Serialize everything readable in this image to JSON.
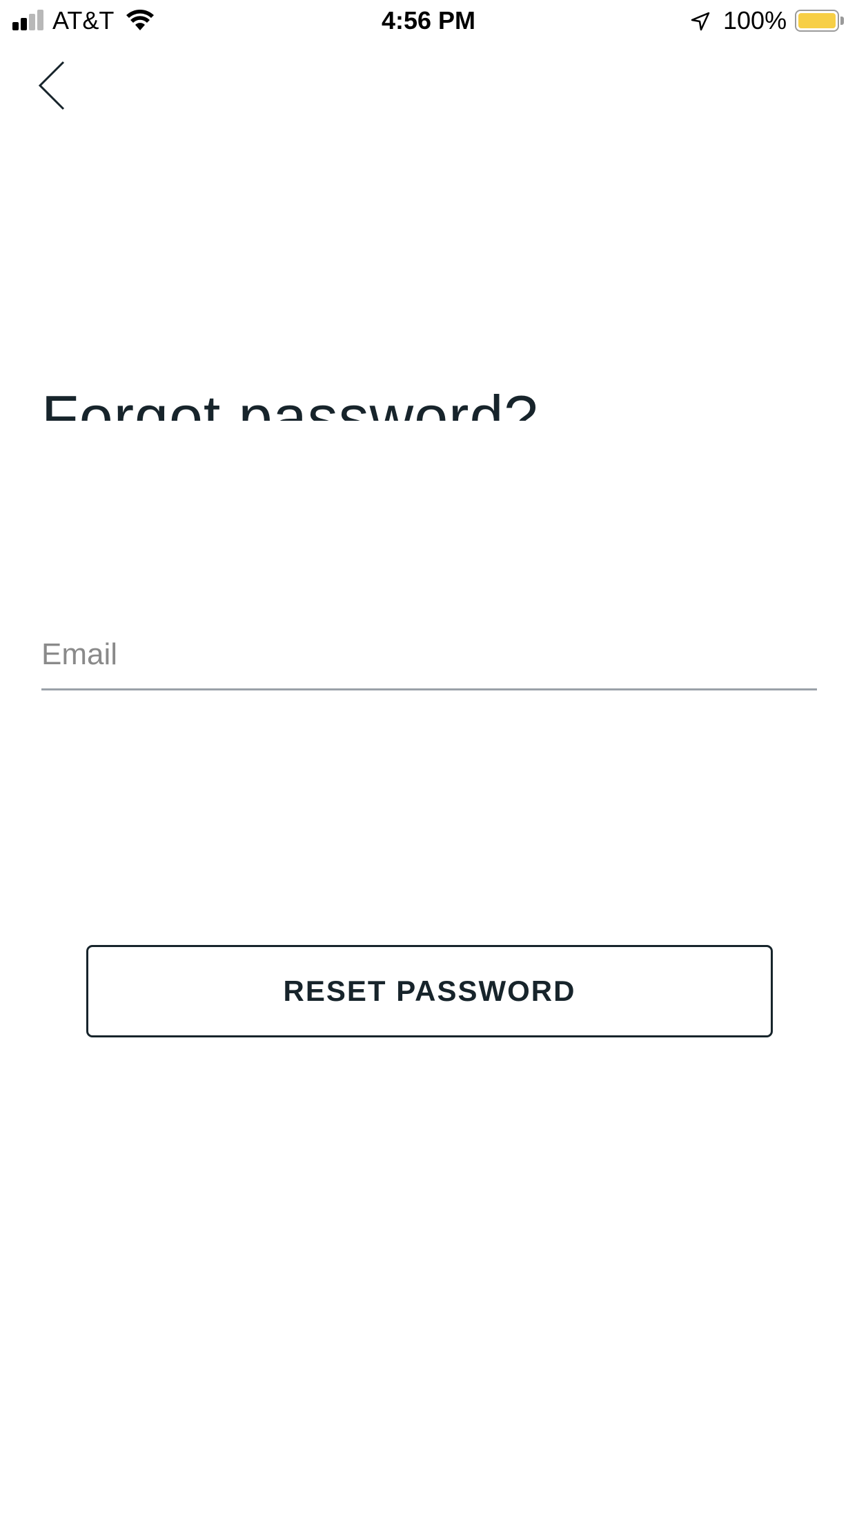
{
  "status_bar": {
    "carrier": "AT&T",
    "time": "4:56 PM",
    "battery_percent": "100%",
    "battery_level": 1.0,
    "battery_color": "#f7cf46",
    "signal_bars_active": 2,
    "signal_bars_total": 4,
    "icons": [
      "signal-icon",
      "wifi-icon",
      "location-arrow-icon",
      "battery-icon"
    ]
  },
  "nav": {
    "back_icon": "chevron-left-icon"
  },
  "page": {
    "title": "Forgot password?"
  },
  "form": {
    "email": {
      "placeholder": "Email",
      "value": ""
    },
    "submit_label": "RESET PASSWORD"
  },
  "colors": {
    "text": "#17242b",
    "placeholder": "#8a8a8a",
    "underline": "#9aa1a8",
    "background": "#ffffff"
  }
}
